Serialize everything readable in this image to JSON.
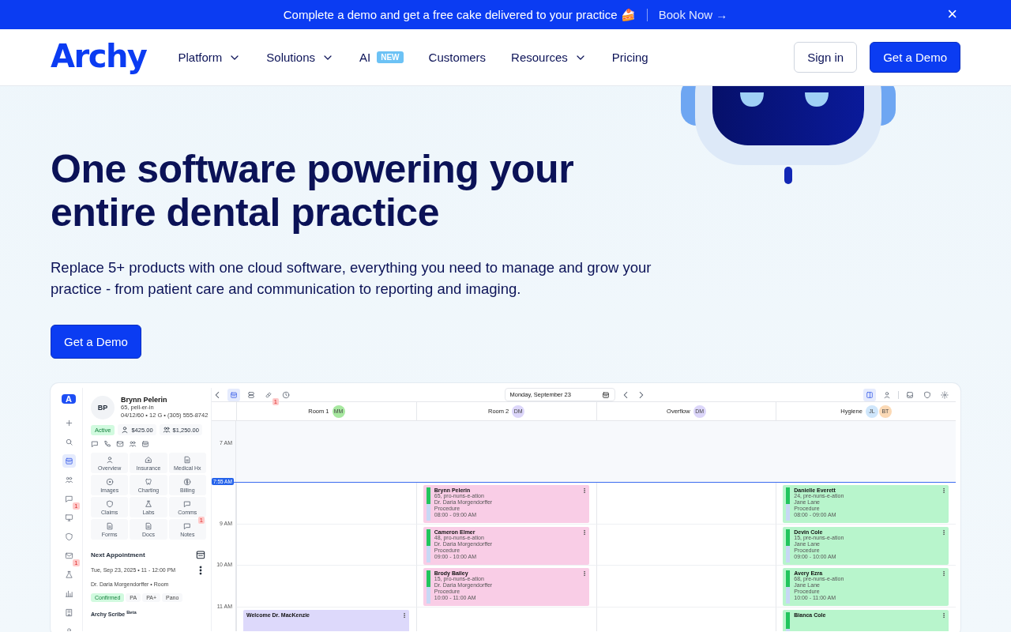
{
  "banner": {
    "message": "Complete a demo and get a free cake delivered to your practice 🍰",
    "link": "Book Now →",
    "close": "×"
  },
  "nav": {
    "logo": "Archy",
    "items": [
      {
        "label": "Platform",
        "dropdown": true
      },
      {
        "label": "Solutions",
        "dropdown": true
      },
      {
        "label": "AI",
        "dropdown": false,
        "badge": "NEW"
      },
      {
        "label": "Customers",
        "dropdown": false
      },
      {
        "label": "Resources",
        "dropdown": true
      },
      {
        "label": "Pricing",
        "dropdown": false
      }
    ],
    "sign_in": "Sign in",
    "cta": "Get a Demo"
  },
  "hero": {
    "title": "One software powering your entire dental practice",
    "subtitle": "Replace 5+ products with one cloud software, everything you need to manage and grow your practice - from patient care and communication to reporting and imaging.",
    "cta": "Get a Demo"
  },
  "app": {
    "logo": "A",
    "rail": [
      {
        "selected": false
      },
      {
        "selected": false
      },
      {
        "selected": true
      },
      {
        "selected": false
      },
      {
        "selected": false,
        "badge": "1"
      },
      {
        "selected": false
      },
      {
        "selected": false
      },
      {
        "selected": false,
        "badge": "1"
      },
      {
        "selected": false
      },
      {
        "selected": false
      },
      {
        "selected": false
      },
      {
        "selected": false
      }
    ],
    "patient": {
      "initials": "BP",
      "name": "Brynn Pelerin",
      "pronunciation": "65, pell-er-in",
      "details": "04/12/60 • 12 G • (305) 555-8742",
      "status": "Active",
      "balance_patient": "$425.00",
      "balance_family": "$1,250.00",
      "tiles": [
        {
          "label": "Overview"
        },
        {
          "label": "Insurance"
        },
        {
          "label": "Medical Hx"
        },
        {
          "label": "Images"
        },
        {
          "label": "Charting"
        },
        {
          "label": "Billing"
        },
        {
          "label": "Claims"
        },
        {
          "label": "Labs"
        },
        {
          "label": "Comms"
        },
        {
          "label": "Forms"
        },
        {
          "label": "Docs"
        },
        {
          "label": "Notes",
          "badge": "1"
        }
      ],
      "next_title": "Next Appointment",
      "next_when": "Tue, Sep 23, 2025 • 11 - 12:00 PM",
      "next_who": "Dr. Daria Morgendorffer • Room",
      "chips": [
        {
          "label": "Confirmed",
          "selected": true
        },
        {
          "label": "PA",
          "selected": false
        },
        {
          "label": "PA+",
          "selected": false
        },
        {
          "label": "Pano",
          "selected": false
        }
      ],
      "scribe": "Archy Scribe $^{Beta}$"
    },
    "toolbar": {
      "views": [
        {
          "selected": true
        },
        {
          "selected": false
        },
        {
          "selected": false,
          "badge": "1"
        },
        {
          "selected": false
        }
      ],
      "date": "Monday, September 23",
      "right": [
        {
          "selected": true
        },
        {
          "selected": false
        },
        {
          "selected": false
        },
        {
          "selected": false
        },
        {
          "selected": false
        }
      ]
    },
    "calendar": {
      "early_hour": "7 AM",
      "now": "7:55 AM",
      "hours": [
        "9 AM",
        "10 AM",
        "11 AM"
      ],
      "rooms": [
        {
          "name": "Room 1",
          "avatars": [
            {
              "initials": "MM",
              "color": "#a7e8a0"
            }
          ],
          "slots": [
            {
              "kind": "open"
            },
            {
              "kind": "open"
            },
            {
              "kind": "open"
            },
            {
              "kind": "event",
              "name": "Welcome Dr. MacKenzie",
              "color": "#ddd9fb"
            }
          ]
        },
        {
          "name": "Room 2",
          "avatars": [
            {
              "initials": "DM",
              "color": "#dcd6fa"
            }
          ],
          "slots": [
            {
              "kind": "patient",
              "name": "Brynn Pelerin",
              "color": "#f9cde6",
              "lines": [
                "65, pro-nuns-e-ation",
                "Dr. Daria Morgendorffer",
                "Procedure",
                "08:00 - 09:00 AM"
              ]
            },
            {
              "kind": "patient",
              "name": "Cameron Elmer",
              "color": "#f9cde6",
              "lines": [
                "48, pro-nuns-e-ation",
                "Dr. Daria Morgendorffer",
                "Procedure",
                "09:00 - 10:00 AM"
              ]
            },
            {
              "kind": "patient",
              "name": "Brody Bailey",
              "color": "#f9cde6",
              "lines": [
                "15, pro-nuns-e-ation",
                "Dr. Daria Morgendorffer",
                "Procedure",
                "10:00 - 11:00 AM"
              ]
            },
            {
              "kind": "open"
            }
          ]
        },
        {
          "name": "Overflow",
          "avatars": [
            {
              "initials": "DM",
              "color": "#dcd6fa"
            }
          ],
          "slots": [
            {
              "kind": "open"
            },
            {
              "kind": "open"
            },
            {
              "kind": "open"
            },
            {
              "kind": "open"
            }
          ]
        },
        {
          "name": "Hygiene",
          "avatars": [
            {
              "initials": "JL",
              "color": "#cfe6fb"
            },
            {
              "initials": "BT",
              "color": "#fbd9b5"
            }
          ],
          "slots": [
            {
              "kind": "patient",
              "name": "Danielle Everett",
              "color": "#b8f5cc",
              "lines": [
                "24, pre-nuns-e-ation",
                "Jane Lane",
                "Procedure",
                "08:00 - 09:00 AM"
              ]
            },
            {
              "kind": "patient",
              "name": "Devin Cole",
              "color": "#b8f5cc",
              "lines": [
                "15, pre-nuns-e-ation",
                "Jane Lane",
                "Procedure",
                "09:00 - 10:00 AM"
              ]
            },
            {
              "kind": "patient",
              "name": "Avery Ezra",
              "color": "#b8f5cc",
              "lines": [
                "68, pre-nuns-e-ation",
                "Jane Lane",
                "Procedure",
                "10:00 - 11:00 AM"
              ]
            },
            {
              "kind": "patient",
              "name": "Bianca Cole",
              "color": "#b8f5cc"
            }
          ]
        }
      ]
    }
  }
}
